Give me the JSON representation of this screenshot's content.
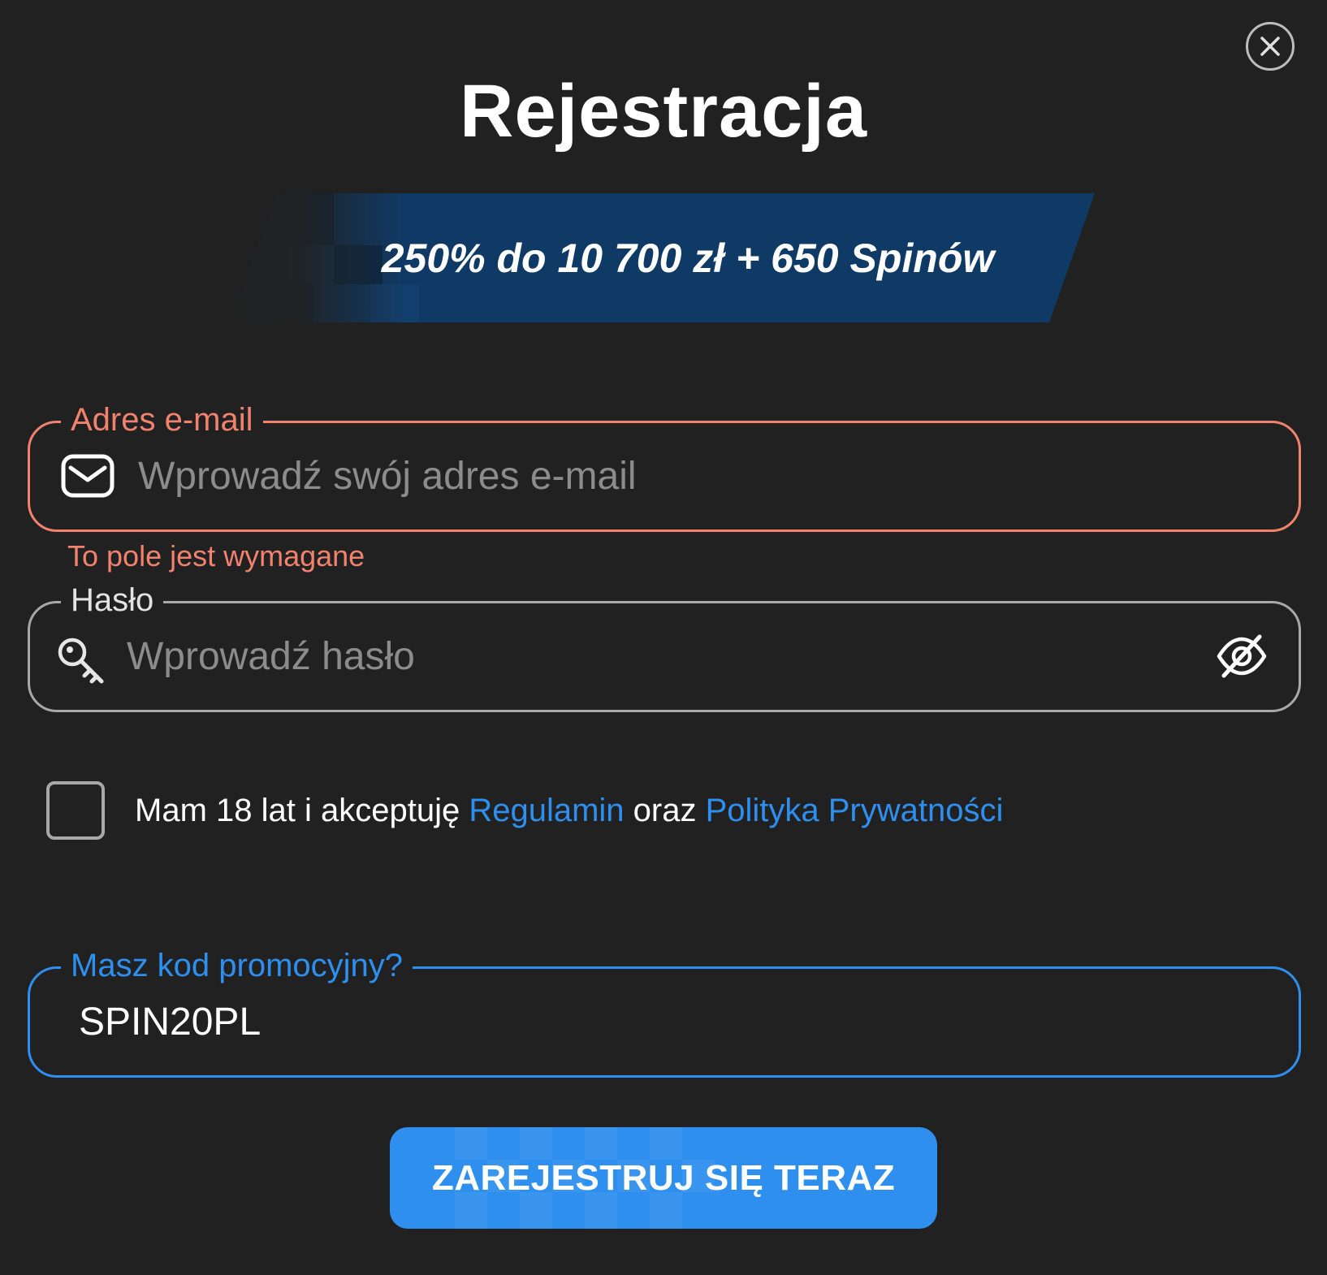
{
  "modal": {
    "title": "Rejestracja",
    "close_icon": "close-icon"
  },
  "banner": {
    "text": "250% do 10 700 zł + 650 Spinów",
    "color": "#0f3a66"
  },
  "email": {
    "label": "Adres e-mail",
    "placeholder": "Wprowadź swój adres e-mail",
    "value": "",
    "icon": "envelope-icon",
    "error": "To pole jest wymagane",
    "border_color": "#f0826e"
  },
  "password": {
    "label": "Hasło",
    "placeholder": "Wprowadź hasło",
    "value": "",
    "icon": "key-icon",
    "toggle_icon": "eye-off-icon"
  },
  "consent": {
    "checked": false,
    "text_before": "Mam 18 lat i akceptuję ",
    "terms_link": "Regulamin",
    "text_middle": " oraz ",
    "privacy_link": "Polityka Prywatności"
  },
  "promo": {
    "label": "Masz kod promocyjny?",
    "value": "SPIN20PL",
    "border_color": "#2e8fef"
  },
  "submit": {
    "label": "ZAREJESTRUJ SIĘ TERAZ",
    "color": "#2e8fef"
  }
}
